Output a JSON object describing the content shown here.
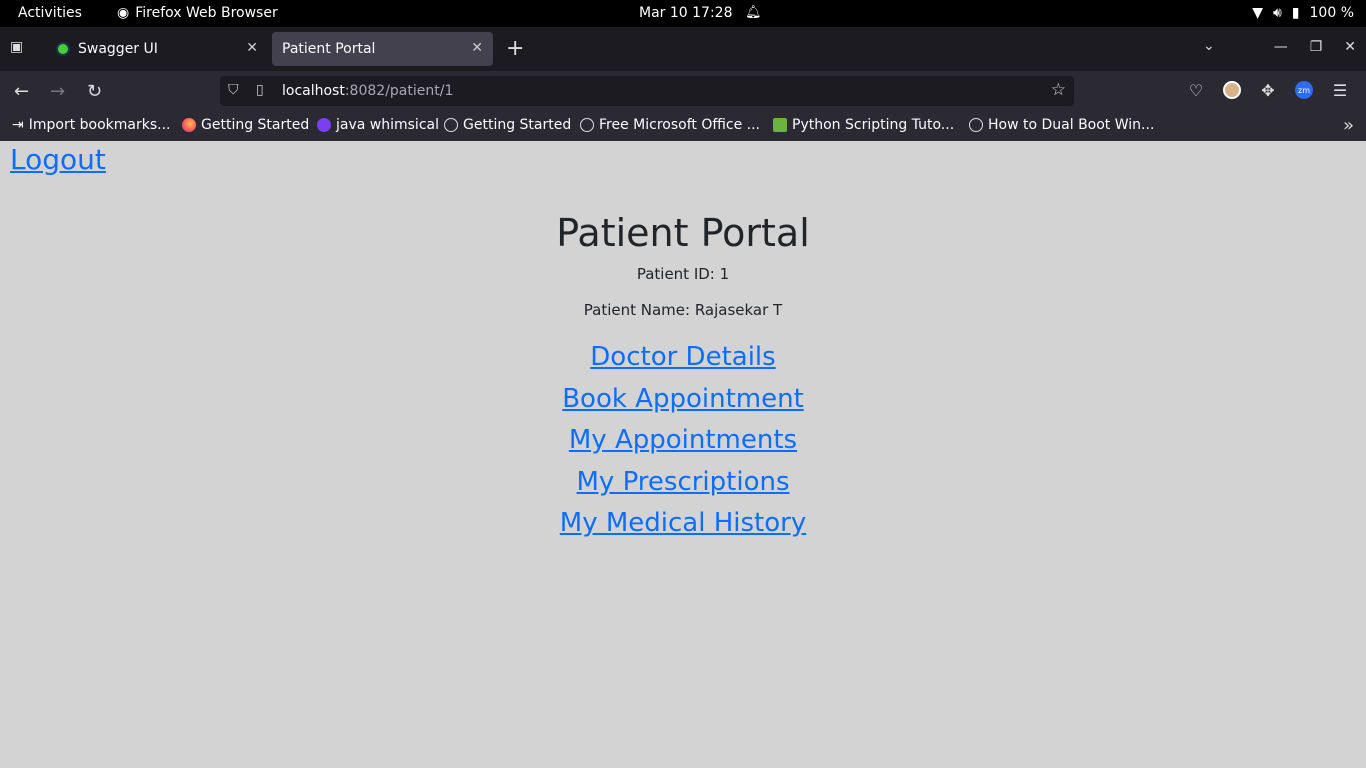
{
  "system_bar": {
    "activities": "Activities",
    "app_name": "Firefox Web Browser",
    "datetime": "Mar 10  17:28",
    "battery": "100 %"
  },
  "tabs": [
    {
      "title": "Swagger UI",
      "active": false
    },
    {
      "title": "Patient Portal",
      "active": true
    }
  ],
  "address_bar": {
    "host": "localhost",
    "path": ":8082/patient/1"
  },
  "bookmarks": [
    {
      "label": "Import bookmarks...",
      "icon": "import-icon"
    },
    {
      "label": "Getting Started",
      "icon": "firefox-icon"
    },
    {
      "label": "java whimsical",
      "icon": "whimsical-icon"
    },
    {
      "label": "Getting Started",
      "icon": "globe-icon"
    },
    {
      "label": "Free Microsoft Office ...",
      "icon": "globe-icon"
    },
    {
      "label": "Python Scripting Tuto...",
      "icon": "python-icon"
    },
    {
      "label": "How to Dual Boot Win...",
      "icon": "globe-icon"
    }
  ],
  "page": {
    "logout": "Logout",
    "title": "Patient Portal",
    "patient_id": "Patient ID: 1",
    "patient_name": "Patient Name: Rajasekar T",
    "links": [
      "Doctor Details",
      "Book Appointment",
      "My Appointments",
      "My Prescriptions",
      "My Medical History"
    ]
  },
  "colors": {
    "link": "#0d6efd",
    "page_background": "#d3d3d3",
    "toolbar": "#2b2a33"
  }
}
